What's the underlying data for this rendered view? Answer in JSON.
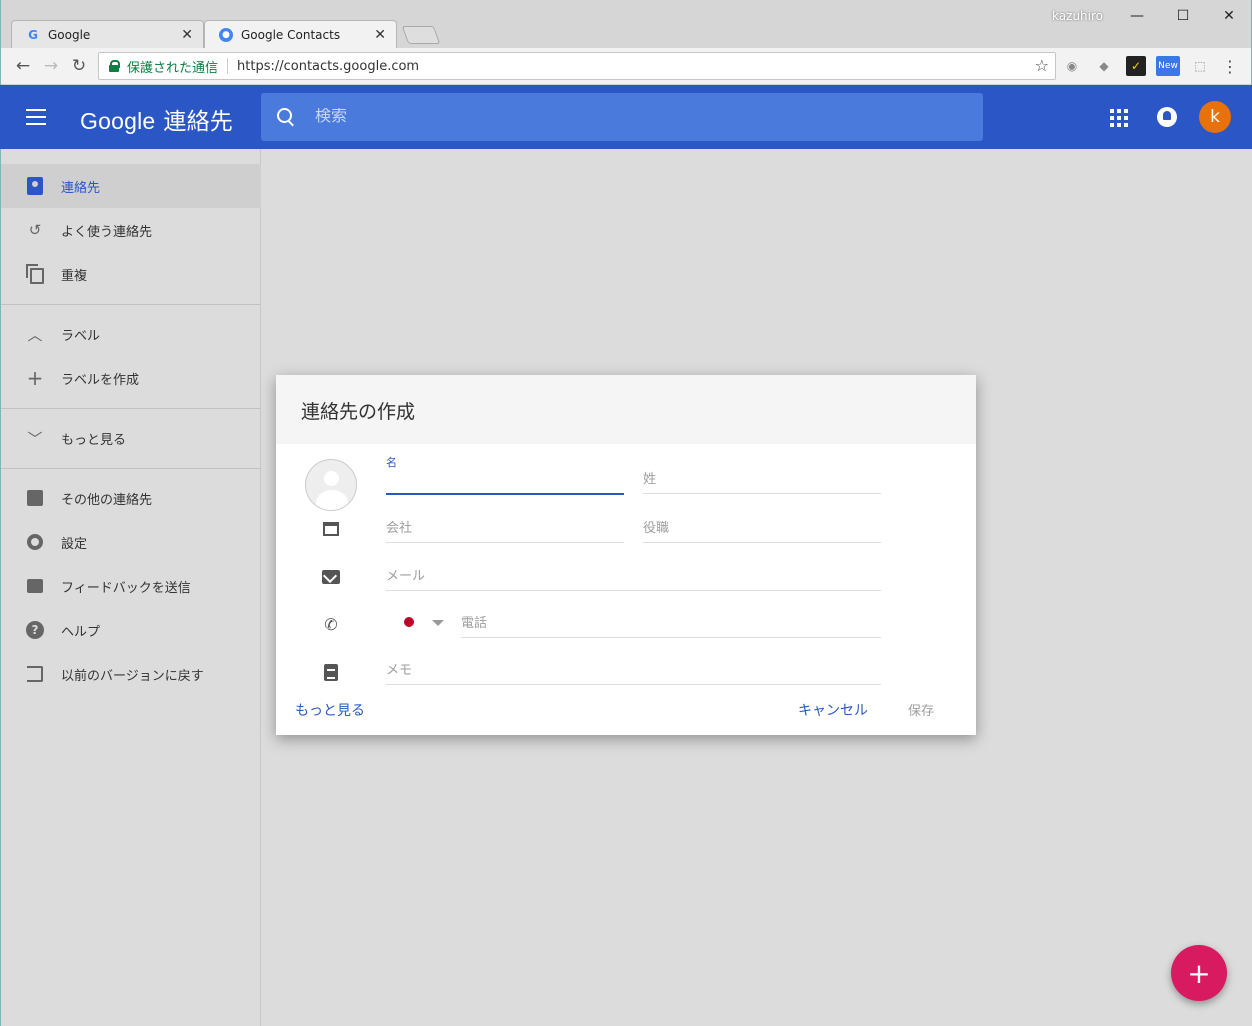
{
  "browser": {
    "tabs": [
      {
        "title": "Google",
        "active": false
      },
      {
        "title": "Google Contacts",
        "active": true
      }
    ],
    "user": "kazuhiro",
    "secure_label": "保護された通信",
    "url": "https://contacts.google.com",
    "extension_badge": "New"
  },
  "appbar": {
    "brand_google": "Google",
    "brand_product": "連絡先",
    "search_placeholder": "検索",
    "avatar_letter": "k"
  },
  "sidebar": {
    "items": [
      {
        "label": "連絡先",
        "icon": "contacts-icon",
        "active": true
      },
      {
        "label": "よく使う連絡先",
        "icon": "history-icon"
      },
      {
        "label": "重複",
        "icon": "copy-icon"
      },
      {
        "label": "ラベル",
        "icon": "chevron-up-icon"
      },
      {
        "label": "ラベルを作成",
        "icon": "plus-icon"
      },
      {
        "label": "もっと見る",
        "icon": "chevron-down-icon"
      },
      {
        "label": "その他の連絡先",
        "icon": "archive-icon"
      },
      {
        "label": "設定",
        "icon": "gear-icon"
      },
      {
        "label": "フィードバックを送信",
        "icon": "feedback-icon"
      },
      {
        "label": "ヘルプ",
        "icon": "help-icon"
      },
      {
        "label": "以前のバージョンに戻す",
        "icon": "exit-icon"
      }
    ]
  },
  "dialog": {
    "title": "連絡先の作成",
    "first_name_label": "名",
    "last_name_placeholder": "姓",
    "company_placeholder": "会社",
    "job_title_placeholder": "役職",
    "email_placeholder": "メール",
    "phone_placeholder": "電話",
    "notes_placeholder": "メモ",
    "more_label": "もっと見る",
    "cancel_label": "キャンセル",
    "save_label": "保存"
  },
  "fab": {
    "label": "+"
  },
  "colors": {
    "primary": "#2a56c6",
    "fab": "#d81b60",
    "avatar": "#e8710a"
  }
}
